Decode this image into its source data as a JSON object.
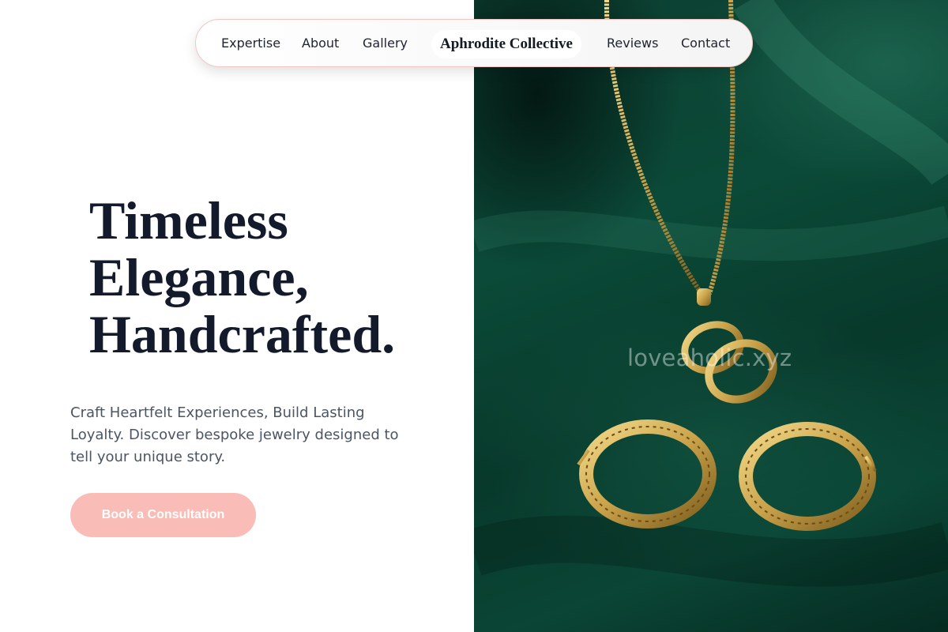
{
  "nav": {
    "links": [
      {
        "label": "Expertise"
      },
      {
        "label": "About"
      },
      {
        "label": "Gallery"
      },
      {
        "label": "Reviews"
      },
      {
        "label": "Contact"
      }
    ],
    "brand": "Aphrodite Collective"
  },
  "hero": {
    "title_lines": [
      "Timeless",
      "Elegance,",
      "Handcrafted."
    ],
    "subtitle": "Craft Heartfelt Experiences, Build Lasting Loyalty. Discover bespoke jewelry designed to tell your unique story.",
    "cta_label": "Book a Consultation"
  },
  "image": {
    "watermark": "loveaholic.xyz",
    "subject": "gold necklace with pendant and greek-key hoop earrings on green satin"
  },
  "colors": {
    "accent": "#f9bcb6",
    "title_text": "#131a2b",
    "body_text": "#4b5563",
    "satin": "#0b4a38",
    "gold": "#c9a24a"
  }
}
